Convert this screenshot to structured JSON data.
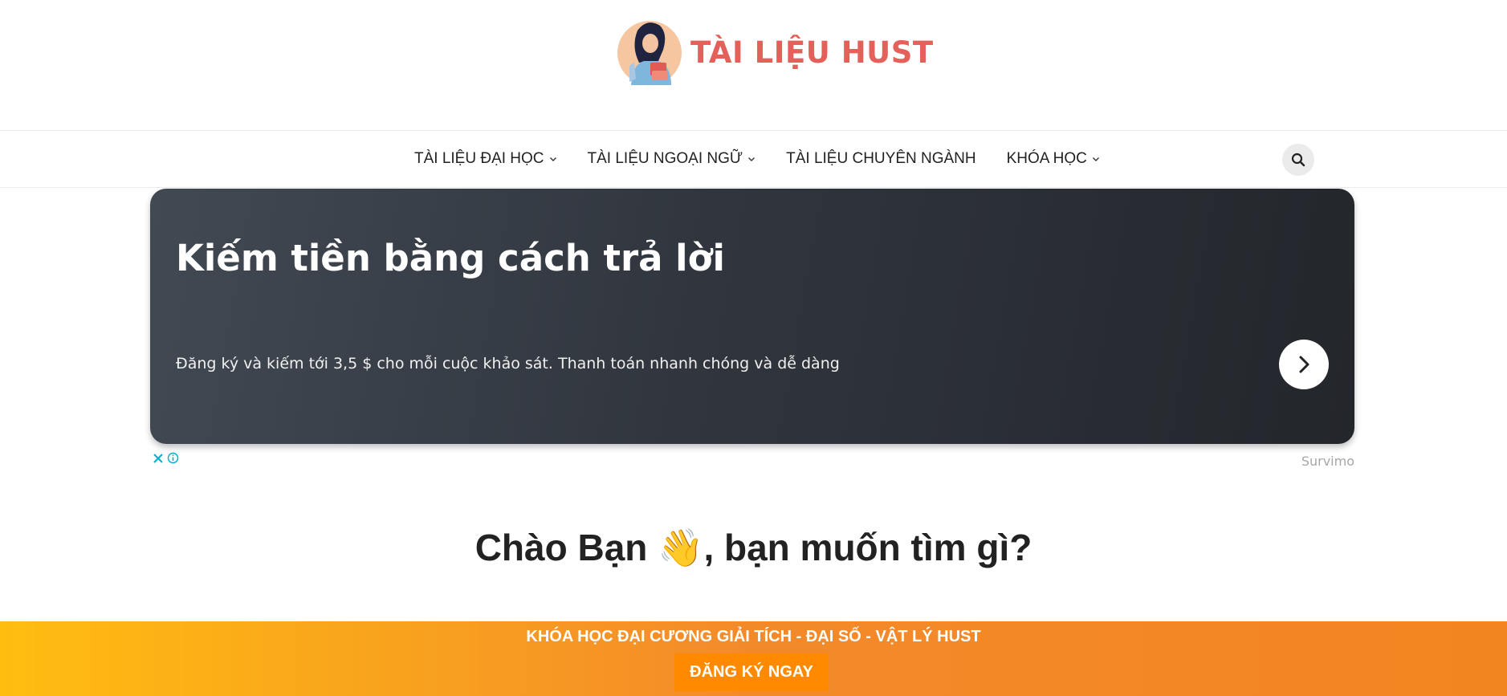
{
  "site": {
    "logo_text": "TÀI LIỆU HUST",
    "colors": {
      "brand": "#e4605a",
      "banner_start": "#ffbd10",
      "banner_end": "#f38520",
      "button": "#ff8a00"
    }
  },
  "nav": {
    "items": [
      {
        "label": "TÀI LIỆU ĐẠI HỌC",
        "icon": "chevron-down-icon"
      },
      {
        "label": "TÀI LIỆU NGOẠI NGỮ",
        "icon": "chevron-down-icon"
      },
      {
        "label": "TÀI LIỆU CHUYÊN NGÀNH"
      },
      {
        "label": "KHÓA HỌC",
        "icon": "chevron-down-icon"
      }
    ],
    "search_icon": "search-icon"
  },
  "ad": {
    "title": "Kiếm tiền bằng cách trả lời",
    "description": "Đăng ký và kiếm tới 3,5 $ cho mỗi cuộc khảo sát. Thanh toán nhanh chóng và dễ dàng",
    "brand": "Survimo",
    "icons": [
      "arrow-right-icon",
      "close-icon",
      "info-icon"
    ]
  },
  "greeting": {
    "prefix": "Chào Bạn ",
    "emoji": "👋",
    "suffix": ", bạn muốn tìm gì?"
  },
  "banner": {
    "text": "KHÓA HỌC ĐẠI CƯƠNG GIẢI TÍCH - ĐẠI SỐ - VẬT LÝ HUST",
    "button_label": "ĐĂNG KÝ NGAY"
  }
}
